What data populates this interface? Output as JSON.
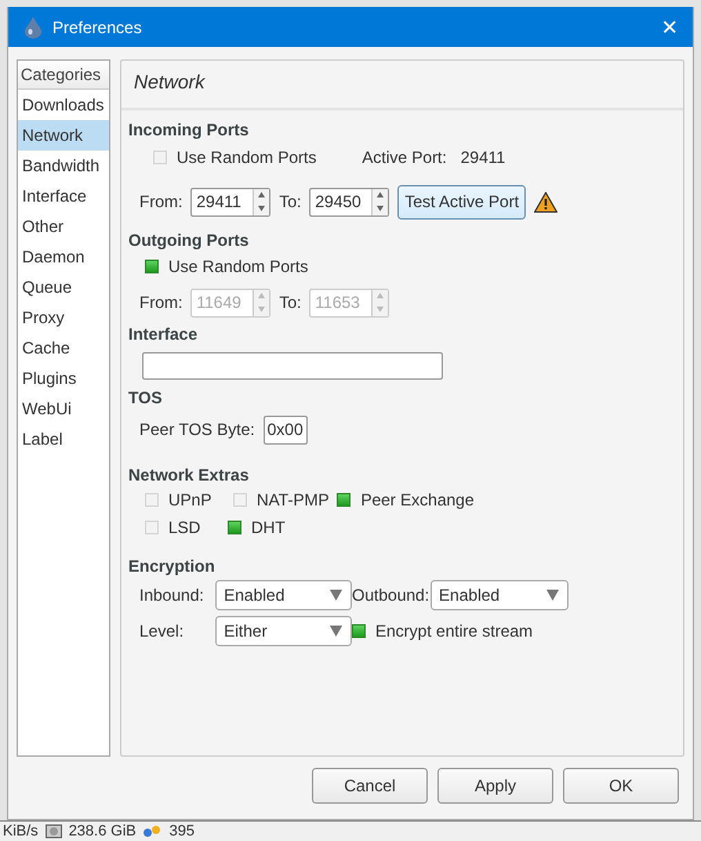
{
  "window": {
    "title": "Preferences",
    "close": "✕"
  },
  "categories": {
    "header": "Categories",
    "items": [
      {
        "label": "Downloads",
        "selected": false
      },
      {
        "label": "Network",
        "selected": true
      },
      {
        "label": "Bandwidth",
        "selected": false
      },
      {
        "label": "Interface",
        "selected": false
      },
      {
        "label": "Other",
        "selected": false
      },
      {
        "label": "Daemon",
        "selected": false
      },
      {
        "label": "Queue",
        "selected": false
      },
      {
        "label": "Proxy",
        "selected": false
      },
      {
        "label": "Cache",
        "selected": false
      },
      {
        "label": "Plugins",
        "selected": false
      },
      {
        "label": "WebUi",
        "selected": false
      },
      {
        "label": "Label",
        "selected": false
      }
    ]
  },
  "page_title": "Network",
  "incoming_ports": {
    "heading": "Incoming Ports",
    "use_random": {
      "label": "Use Random Ports",
      "checked": false
    },
    "active_port_label": "Active Port:",
    "active_port": "29411",
    "from": {
      "label": "From:",
      "value": "29411",
      "disabled": false
    },
    "to": {
      "label": "To:",
      "value": "29450",
      "disabled": false
    },
    "test_button": "Test Active Port"
  },
  "outgoing_ports": {
    "heading": "Outgoing Ports",
    "use_random": {
      "label": "Use Random Ports",
      "checked": true
    },
    "from": {
      "label": "From:",
      "value": "11649",
      "disabled": true
    },
    "to": {
      "label": "To:",
      "value": "11653",
      "disabled": true
    }
  },
  "interface": {
    "heading": "Interface"
  },
  "tos": {
    "heading": "TOS",
    "label": "Peer TOS Byte:",
    "value": "0x00"
  },
  "network_extras": {
    "heading": "Network Extras",
    "rows": [
      [
        {
          "label": "UPnP",
          "checked": false
        },
        {
          "label": "NAT-PMP",
          "checked": false
        },
        {
          "label": "Peer Exchange",
          "checked": true
        }
      ],
      [
        {
          "label": "LSD",
          "checked": false
        },
        {
          "label": "DHT",
          "checked": true
        }
      ]
    ]
  },
  "encryption": {
    "heading": "Encryption",
    "inbound": {
      "label": "Inbound:",
      "value": "Enabled"
    },
    "outbound": {
      "label": "Outbound:",
      "value": "Enabled"
    },
    "level": {
      "label": "Level:",
      "value": "Either"
    },
    "encrypt_stream": {
      "label": "Encrypt entire stream",
      "checked": true
    }
  },
  "buttons": [
    "Cancel",
    "Apply",
    "OK"
  ],
  "status_bar": [
    "KiB/s",
    "238.6 GiB",
    "395"
  ]
}
